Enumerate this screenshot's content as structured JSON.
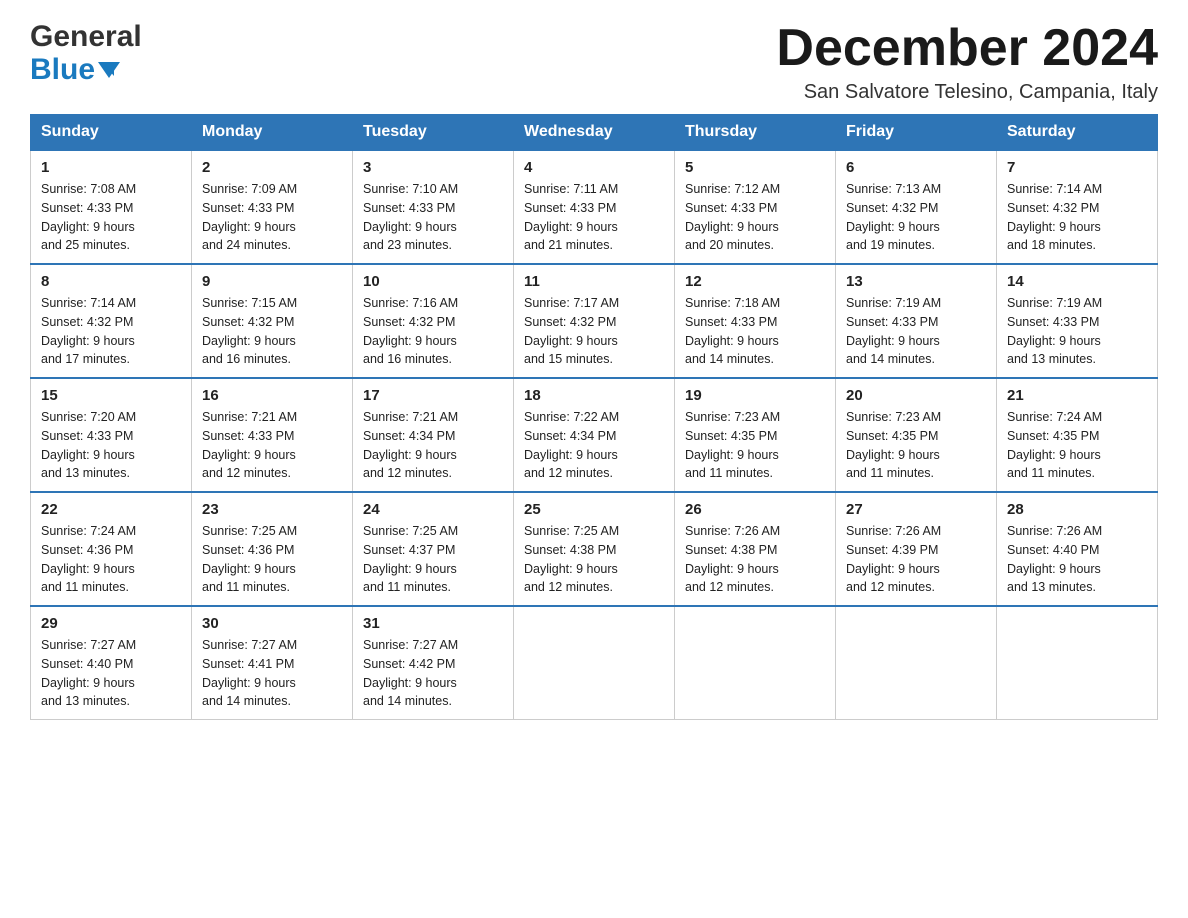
{
  "header": {
    "logo": {
      "general": "General",
      "blue": "Blue",
      "aria": "GeneralBlue logo"
    },
    "title": "December 2024",
    "location": "San Salvatore Telesino, Campania, Italy"
  },
  "days_of_week": [
    "Sunday",
    "Monday",
    "Tuesday",
    "Wednesday",
    "Thursday",
    "Friday",
    "Saturday"
  ],
  "weeks": [
    [
      {
        "day": "1",
        "sunrise": "7:08 AM",
        "sunset": "4:33 PM",
        "daylight": "9 hours and 25 minutes."
      },
      {
        "day": "2",
        "sunrise": "7:09 AM",
        "sunset": "4:33 PM",
        "daylight": "9 hours and 24 minutes."
      },
      {
        "day": "3",
        "sunrise": "7:10 AM",
        "sunset": "4:33 PM",
        "daylight": "9 hours and 23 minutes."
      },
      {
        "day": "4",
        "sunrise": "7:11 AM",
        "sunset": "4:33 PM",
        "daylight": "9 hours and 21 minutes."
      },
      {
        "day": "5",
        "sunrise": "7:12 AM",
        "sunset": "4:33 PM",
        "daylight": "9 hours and 20 minutes."
      },
      {
        "day": "6",
        "sunrise": "7:13 AM",
        "sunset": "4:32 PM",
        "daylight": "9 hours and 19 minutes."
      },
      {
        "day": "7",
        "sunrise": "7:14 AM",
        "sunset": "4:32 PM",
        "daylight": "9 hours and 18 minutes."
      }
    ],
    [
      {
        "day": "8",
        "sunrise": "7:14 AM",
        "sunset": "4:32 PM",
        "daylight": "9 hours and 17 minutes."
      },
      {
        "day": "9",
        "sunrise": "7:15 AM",
        "sunset": "4:32 PM",
        "daylight": "9 hours and 16 minutes."
      },
      {
        "day": "10",
        "sunrise": "7:16 AM",
        "sunset": "4:32 PM",
        "daylight": "9 hours and 16 minutes."
      },
      {
        "day": "11",
        "sunrise": "7:17 AM",
        "sunset": "4:32 PM",
        "daylight": "9 hours and 15 minutes."
      },
      {
        "day": "12",
        "sunrise": "7:18 AM",
        "sunset": "4:33 PM",
        "daylight": "9 hours and 14 minutes."
      },
      {
        "day": "13",
        "sunrise": "7:19 AM",
        "sunset": "4:33 PM",
        "daylight": "9 hours and 14 minutes."
      },
      {
        "day": "14",
        "sunrise": "7:19 AM",
        "sunset": "4:33 PM",
        "daylight": "9 hours and 13 minutes."
      }
    ],
    [
      {
        "day": "15",
        "sunrise": "7:20 AM",
        "sunset": "4:33 PM",
        "daylight": "9 hours and 13 minutes."
      },
      {
        "day": "16",
        "sunrise": "7:21 AM",
        "sunset": "4:33 PM",
        "daylight": "9 hours and 12 minutes."
      },
      {
        "day": "17",
        "sunrise": "7:21 AM",
        "sunset": "4:34 PM",
        "daylight": "9 hours and 12 minutes."
      },
      {
        "day": "18",
        "sunrise": "7:22 AM",
        "sunset": "4:34 PM",
        "daylight": "9 hours and 12 minutes."
      },
      {
        "day": "19",
        "sunrise": "7:23 AM",
        "sunset": "4:35 PM",
        "daylight": "9 hours and 11 minutes."
      },
      {
        "day": "20",
        "sunrise": "7:23 AM",
        "sunset": "4:35 PM",
        "daylight": "9 hours and 11 minutes."
      },
      {
        "day": "21",
        "sunrise": "7:24 AM",
        "sunset": "4:35 PM",
        "daylight": "9 hours and 11 minutes."
      }
    ],
    [
      {
        "day": "22",
        "sunrise": "7:24 AM",
        "sunset": "4:36 PM",
        "daylight": "9 hours and 11 minutes."
      },
      {
        "day": "23",
        "sunrise": "7:25 AM",
        "sunset": "4:36 PM",
        "daylight": "9 hours and 11 minutes."
      },
      {
        "day": "24",
        "sunrise": "7:25 AM",
        "sunset": "4:37 PM",
        "daylight": "9 hours and 11 minutes."
      },
      {
        "day": "25",
        "sunrise": "7:25 AM",
        "sunset": "4:38 PM",
        "daylight": "9 hours and 12 minutes."
      },
      {
        "day": "26",
        "sunrise": "7:26 AM",
        "sunset": "4:38 PM",
        "daylight": "9 hours and 12 minutes."
      },
      {
        "day": "27",
        "sunrise": "7:26 AM",
        "sunset": "4:39 PM",
        "daylight": "9 hours and 12 minutes."
      },
      {
        "day": "28",
        "sunrise": "7:26 AM",
        "sunset": "4:40 PM",
        "daylight": "9 hours and 13 minutes."
      }
    ],
    [
      {
        "day": "29",
        "sunrise": "7:27 AM",
        "sunset": "4:40 PM",
        "daylight": "9 hours and 13 minutes."
      },
      {
        "day": "30",
        "sunrise": "7:27 AM",
        "sunset": "4:41 PM",
        "daylight": "9 hours and 14 minutes."
      },
      {
        "day": "31",
        "sunrise": "7:27 AM",
        "sunset": "4:42 PM",
        "daylight": "9 hours and 14 minutes."
      },
      null,
      null,
      null,
      null
    ]
  ],
  "labels": {
    "sunrise": "Sunrise:",
    "sunset": "Sunset:",
    "daylight": "Daylight:"
  },
  "colors": {
    "header_bg": "#2e75b6",
    "header_text": "#ffffff",
    "accent": "#1a7abf"
  }
}
